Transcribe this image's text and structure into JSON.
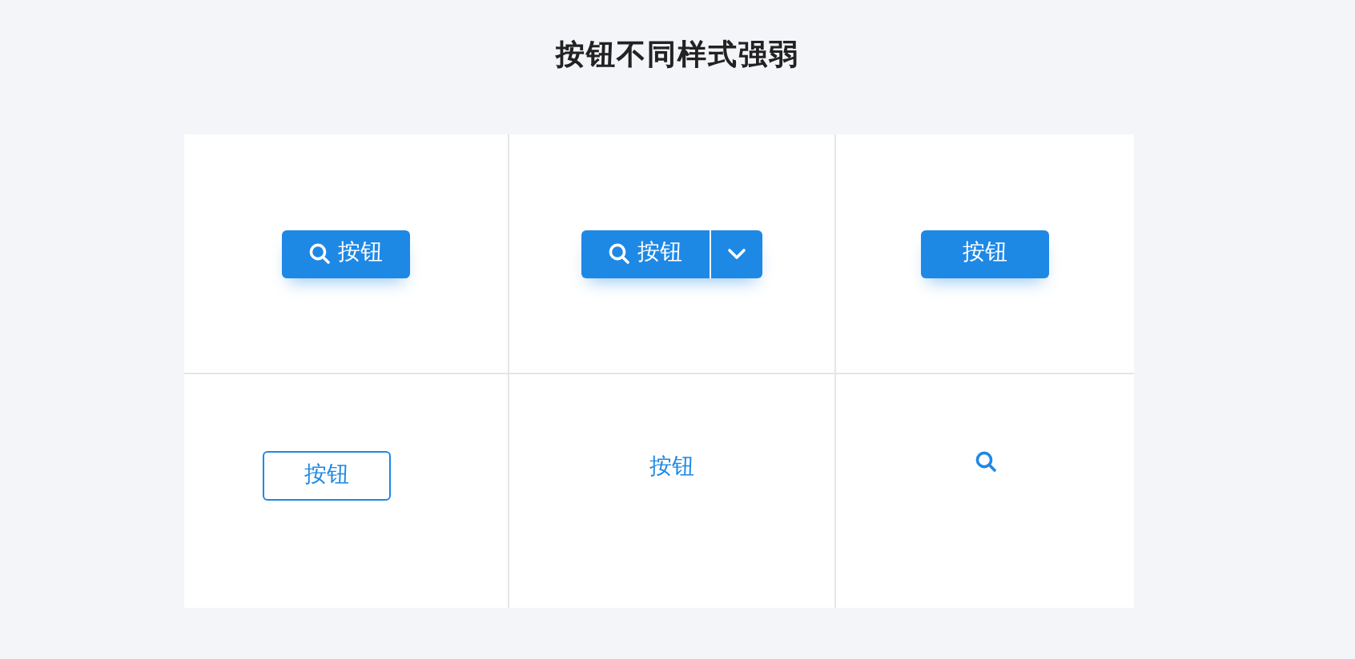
{
  "title": "按钮不同样式强弱",
  "cells": [
    {
      "kind": "primary-icon",
      "label": "按钮"
    },
    {
      "kind": "split",
      "label": "按钮"
    },
    {
      "kind": "primary",
      "label": "按钮"
    },
    {
      "kind": "outline",
      "label": "按钮"
    },
    {
      "kind": "text",
      "label": "按钮"
    },
    {
      "kind": "icon"
    }
  ]
}
